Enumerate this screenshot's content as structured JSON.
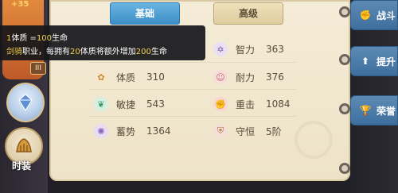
{
  "left": {
    "plus_value": "+35",
    "level_label": "III",
    "fashion_label": "时装"
  },
  "tabs": {
    "basic": "基础",
    "advanced": "高级"
  },
  "tooltip": {
    "line1_a": "1",
    "line1_b": "体质 =",
    "line1_c": "100",
    "line1_d": "生命",
    "line2_a": "剑骑",
    "line2_b": "职业，每拥有",
    "line2_c": "20",
    "line2_d": "体质将额外增加",
    "line2_e": "200",
    "line2_f": "生命"
  },
  "stats": [
    {
      "name": "智力",
      "value": "363",
      "icon": "hexagram-icon"
    },
    {
      "name": "体质",
      "value": "310",
      "icon": "flower-icon"
    },
    {
      "name": "耐力",
      "value": "376",
      "icon": "person-icon"
    },
    {
      "name": "敏捷",
      "value": "543",
      "icon": "feather-icon"
    },
    {
      "name": "重击",
      "value": "1084",
      "icon": "fist-icon"
    },
    {
      "name": "蓄势",
      "value": "1364",
      "icon": "swirl-icon"
    },
    {
      "name": "守恒",
      "value": "5阶",
      "icon": "shield-icon"
    }
  ],
  "side_tabs": [
    {
      "label": "战斗",
      "icon": "fist-icon"
    },
    {
      "label": "提升",
      "icon": "up-arrow-icon"
    },
    {
      "label": "荣誉",
      "icon": "trophy-icon"
    }
  ],
  "colors": {
    "tab_active": "#3d8fc6",
    "highlight": "#f0d34f",
    "side_tab": "#3e6e9d"
  }
}
